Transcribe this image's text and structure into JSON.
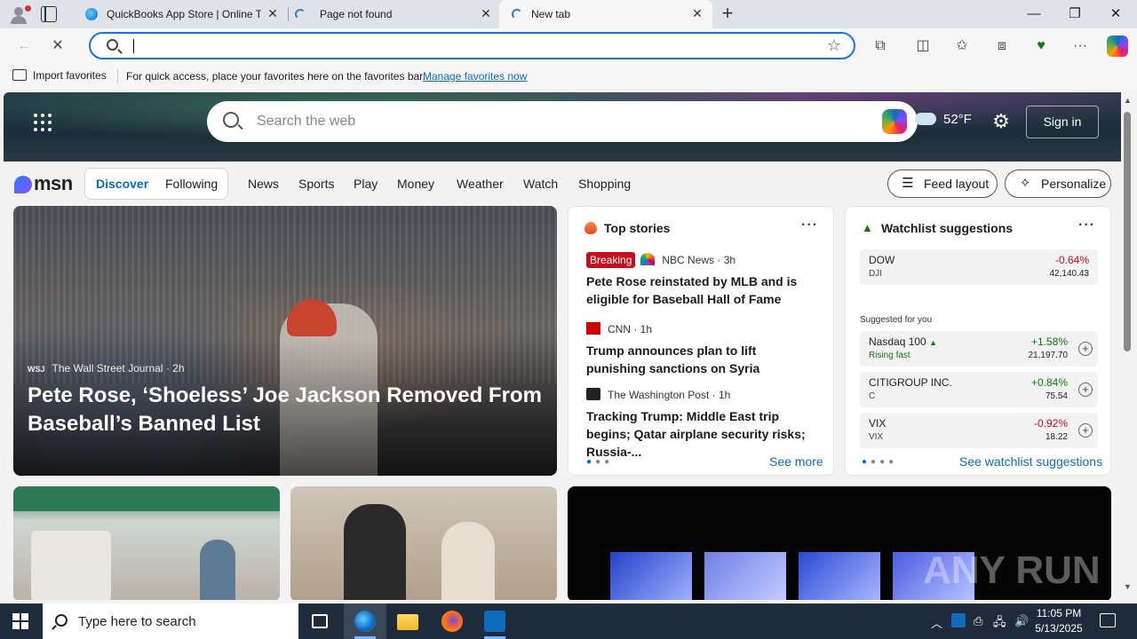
{
  "browser": {
    "tabs": [
      {
        "title": "QuickBooks App Store | Online To",
        "icon": "edge-favicon",
        "active": false
      },
      {
        "title": "Page not found",
        "icon": "loading-spinner",
        "active": false
      },
      {
        "title": "New tab",
        "icon": "loading-spinner",
        "active": true
      }
    ],
    "address": {
      "value": "",
      "placeholder": ""
    },
    "favorites_bar": {
      "import_label": "Import favorites",
      "hint": "For quick access, place your favorites here on the favorites bar.",
      "manage_link": "Manage favorites now"
    }
  },
  "msn": {
    "search_placeholder": "Search the web",
    "weather": {
      "temp": "52°F",
      "icon": "partly-cloudy-icon"
    },
    "signin_label": "Sign in",
    "logo": "msn",
    "feed_toggle": [
      "Discover",
      "Following"
    ],
    "nav": [
      "News",
      "Sports",
      "Play",
      "Money",
      "Weather",
      "Watch",
      "Shopping"
    ],
    "feed_layout_label": "Feed layout",
    "personalize_label": "Personalize",
    "hero": {
      "source": "The Wall Street Journal",
      "age": "2h",
      "headline": "Pete Rose, ‘Shoeless’ Joe Jackson Removed From Baseball’s Banned List"
    },
    "top_stories": {
      "title": "Top stories",
      "items": [
        {
          "badge": "Breaking",
          "source": "NBC News · 3h",
          "title": "Pete Rose reinstated by MLB and is eligible for Baseball Hall of Fame"
        },
        {
          "badge": "",
          "source": "CNN · 1h",
          "title": "Trump announces plan to lift punishing sanctions on Syria"
        },
        {
          "badge": "",
          "source": "The Washington Post · 1h",
          "title": "Tracking Trump: Middle East trip begins; Qatar airplane security risks; Russia-..."
        }
      ],
      "see_more": "See more"
    },
    "watchlist": {
      "title": "Watchlist suggestions",
      "quotes": [
        {
          "symbol": "DOW",
          "sub": "DJI",
          "change": "-0.64%",
          "price": "42,140.43",
          "direction": "down"
        }
      ],
      "suggested_label": "Suggested for you",
      "suggested": [
        {
          "symbol": "Nasdaq 100",
          "sub": "Rising fast",
          "change": "+1.58%",
          "price": "21,197.70",
          "direction": "up"
        },
        {
          "symbol": "CITIGROUP INC.",
          "sub": "C",
          "change": "+0.84%",
          "price": "75.54",
          "direction": "up"
        },
        {
          "symbol": "VIX",
          "sub": "VIX",
          "change": "-0.92%",
          "price": "18.22",
          "direction": "down"
        }
      ],
      "see_more": "See watchlist suggestions"
    },
    "promo_watermark": "ANY RUN"
  },
  "taskbar": {
    "search_placeholder": "Type here to search",
    "time": "11:05 PM",
    "date": "5/13/2025"
  },
  "colors": {
    "accent": "#0f6cbd",
    "down": "#c50f1f",
    "up": "#0e7a0d",
    "taskbar": "#1f2b3a"
  }
}
